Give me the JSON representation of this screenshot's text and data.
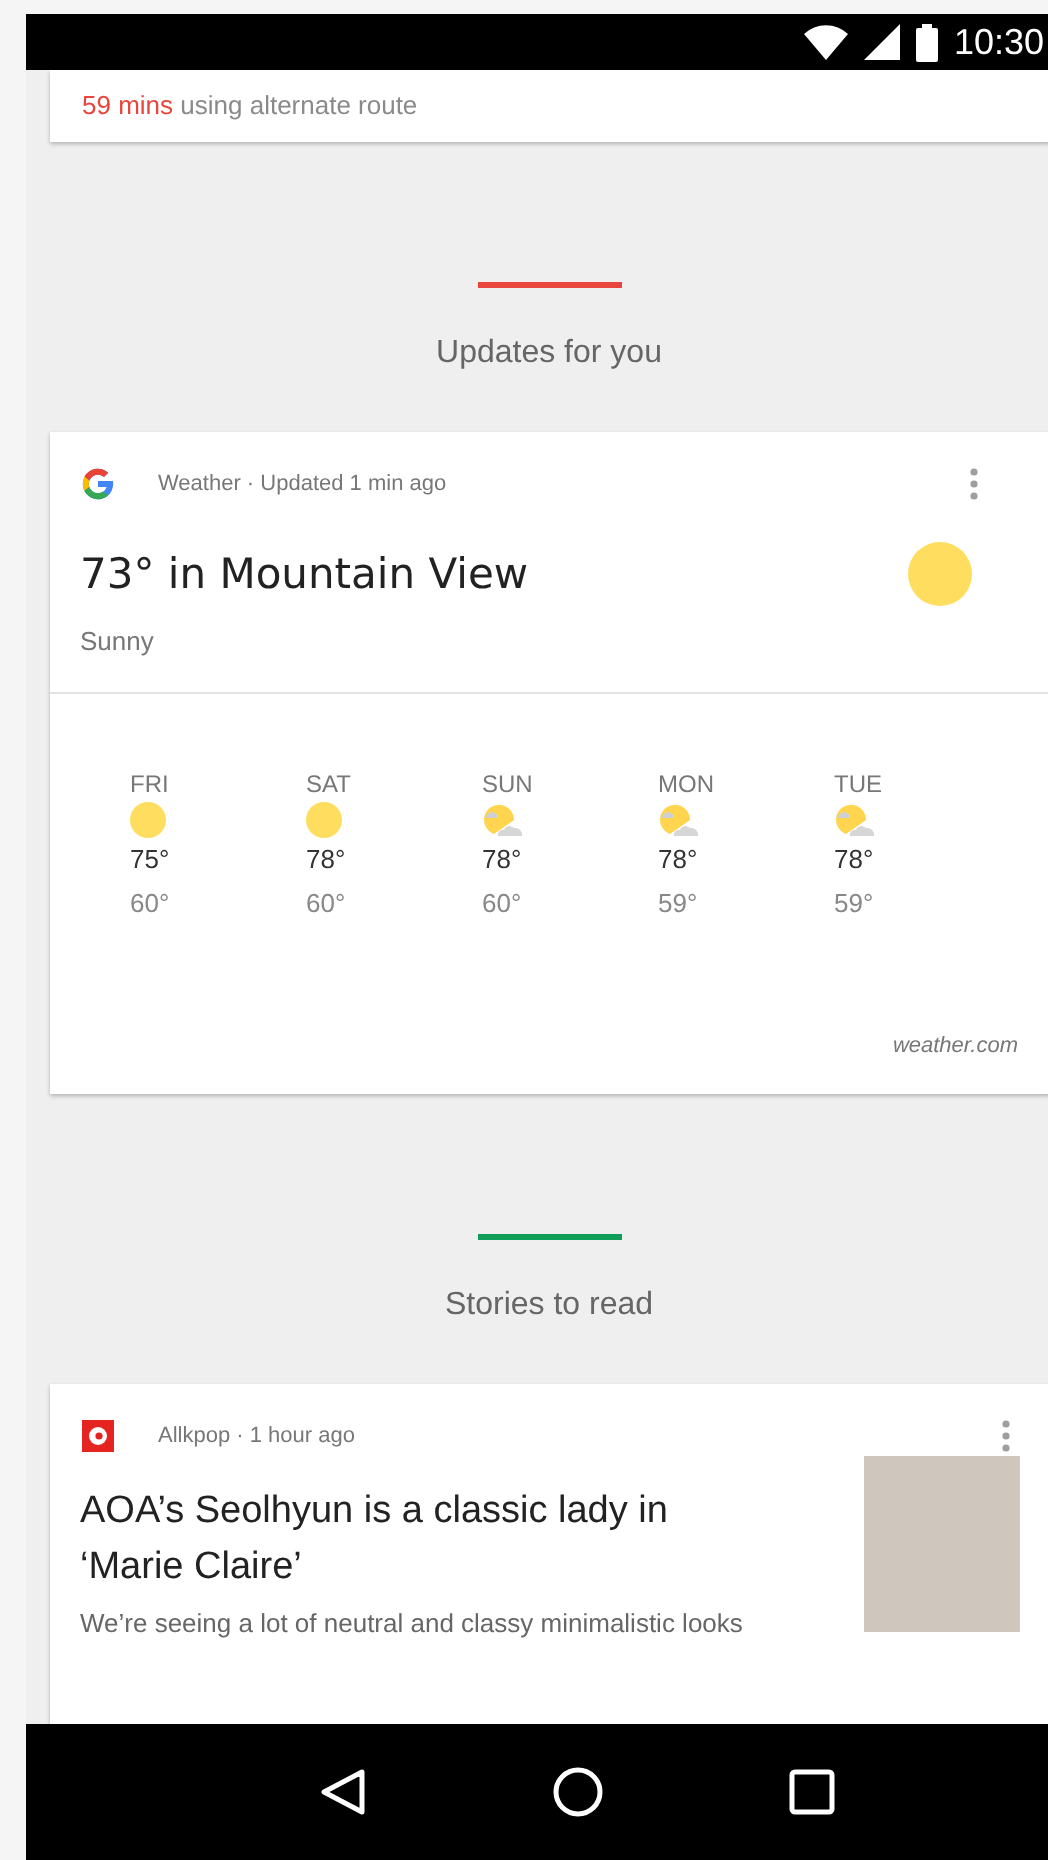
{
  "status_bar": {
    "time": "10:30"
  },
  "traffic_card": {
    "duration": "59 mins",
    "text": "using alternate route"
  },
  "sections": [
    {
      "title": "Updates for you",
      "color": "#e8453c"
    },
    {
      "title": "Stories to read",
      "color": "#0f9d58"
    }
  ],
  "weather_card": {
    "source": "Weather · Updated 1 min ago",
    "title": "73° in Mountain View",
    "condition": "Sunny",
    "credit": "weather.com",
    "forecast": [
      {
        "day": "FRI",
        "kind": "sun",
        "high": "75°",
        "low": "60°"
      },
      {
        "day": "SAT",
        "kind": "sun",
        "high": "78°",
        "low": "60°"
      },
      {
        "day": "SUN",
        "kind": "partly-cloudy",
        "high": "78°",
        "low": "60°"
      },
      {
        "day": "MON",
        "kind": "partly-cloudy",
        "high": "78°",
        "low": "59°"
      },
      {
        "day": "TUE",
        "kind": "partly-cloudy",
        "high": "78°",
        "low": "59°"
      }
    ]
  },
  "story_card": {
    "source": "Allkpop · 1 hour ago",
    "headline": "AOA’s Seolhyun is a classic lady in ‘Marie Claire’",
    "snippet": "We’re seeing a lot of neutral and classy minimalistic looks"
  }
}
